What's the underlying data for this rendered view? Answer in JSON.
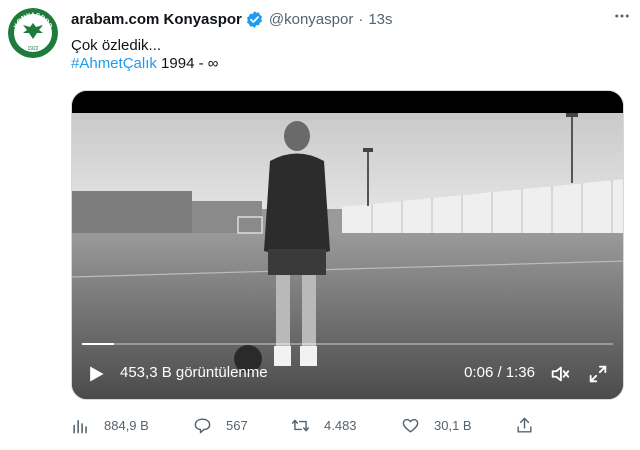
{
  "tweet": {
    "author_name": "arabam.com Konyaspor",
    "handle": "@konyaspor",
    "separator": "·",
    "time": "13s",
    "text_line1": "Çok özledik...",
    "hashtag": "#AhmetÇalık",
    "text_line2_rest": " 1994 - ∞"
  },
  "avatar": {
    "logo_text": "KONYASPOR",
    "year": "1922"
  },
  "video": {
    "views": "453,3 B görüntülenme",
    "timecode": "0:06 / 1:36",
    "progress": 0.06
  },
  "actions": {
    "analytics": "884,9 B",
    "replies": "567",
    "retweets": "4.483",
    "likes": "30,1 B"
  },
  "colors": {
    "accent": "#1d9bf0",
    "muted": "#536471",
    "green": "#1e7b3b"
  }
}
